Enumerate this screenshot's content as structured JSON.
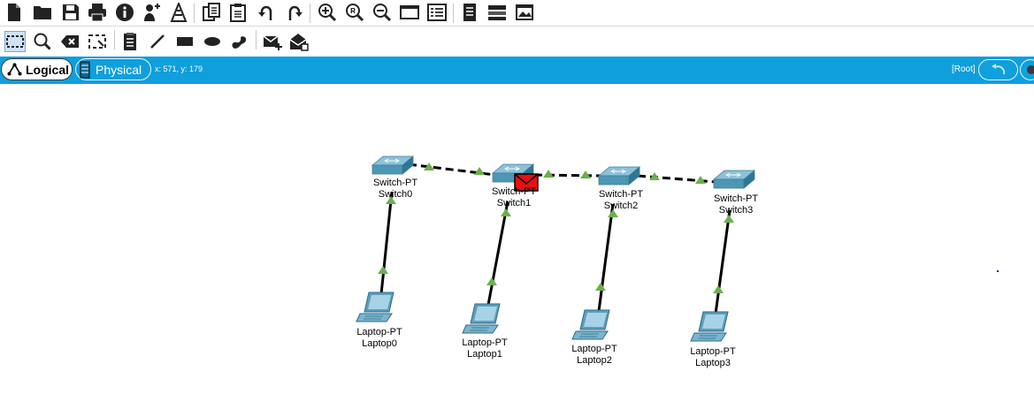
{
  "toolbar_main": {
    "items": [
      "new-file-icon",
      "open-folder-icon",
      "save-icon",
      "print-icon",
      "info-icon",
      "activity-wizard-icon",
      "pdu-icon",
      "copy-icon",
      "paste-icon",
      "undo-icon",
      "redo-icon",
      "zoom-in-icon",
      "zoom-reset-icon",
      "zoom-out-icon",
      "drawing-palette-icon",
      "custom-device-icon",
      "notes-icon",
      "view-list-icon",
      "screenshot-icon"
    ]
  },
  "toolbar_tools": {
    "items": [
      "select-icon",
      "inspect-icon",
      "delete-icon",
      "resize-shape-icon",
      "place-note-icon",
      "draw-line-icon",
      "draw-rectangle-icon",
      "draw-ellipse-icon",
      "freeform-icon",
      "add-simple-pdu-icon",
      "add-complex-pdu-icon"
    ]
  },
  "workspace_bar": {
    "logical_tab": "Logical",
    "physical_tab": "Physical",
    "coordinates": "x: 571, y: 179",
    "root_label": "[Root]"
  },
  "devices": {
    "switch0": {
      "type": "Switch-PT",
      "name": "Switch0"
    },
    "switch1": {
      "type": "Switch-PT",
      "name": "Switch1"
    },
    "switch2": {
      "type": "Switch-PT",
      "name": "Switch2"
    },
    "switch3": {
      "type": "Switch-PT",
      "name": "Switch3"
    },
    "laptop0": {
      "type": "Laptop-PT",
      "name": "Laptop0"
    },
    "laptop1": {
      "type": "Laptop-PT",
      "name": "Laptop1"
    },
    "laptop2": {
      "type": "Laptop-PT",
      "name": "Laptop2"
    },
    "laptop3": {
      "type": "Laptop-PT",
      "name": "Laptop3"
    }
  },
  "links": [
    {
      "from": "switch0",
      "to": "switch1",
      "cable": "crossover",
      "status": "up"
    },
    {
      "from": "switch1",
      "to": "switch2",
      "cable": "crossover",
      "status": "up"
    },
    {
      "from": "switch2",
      "to": "switch3",
      "cable": "crossover",
      "status": "up"
    },
    {
      "from": "laptop0",
      "to": "switch0",
      "cable": "straight",
      "status": "up"
    },
    {
      "from": "laptop1",
      "to": "switch1",
      "cable": "straight",
      "status": "up"
    },
    {
      "from": "laptop2",
      "to": "switch2",
      "cable": "straight",
      "status": "up"
    },
    {
      "from": "laptop3",
      "to": "switch3",
      "cable": "straight",
      "status": "up"
    }
  ],
  "colors": {
    "workspace_bar": "#0f9fdc",
    "link_up": "#6ab04c",
    "device": "#4d97b5",
    "pdu": "#e81010"
  }
}
